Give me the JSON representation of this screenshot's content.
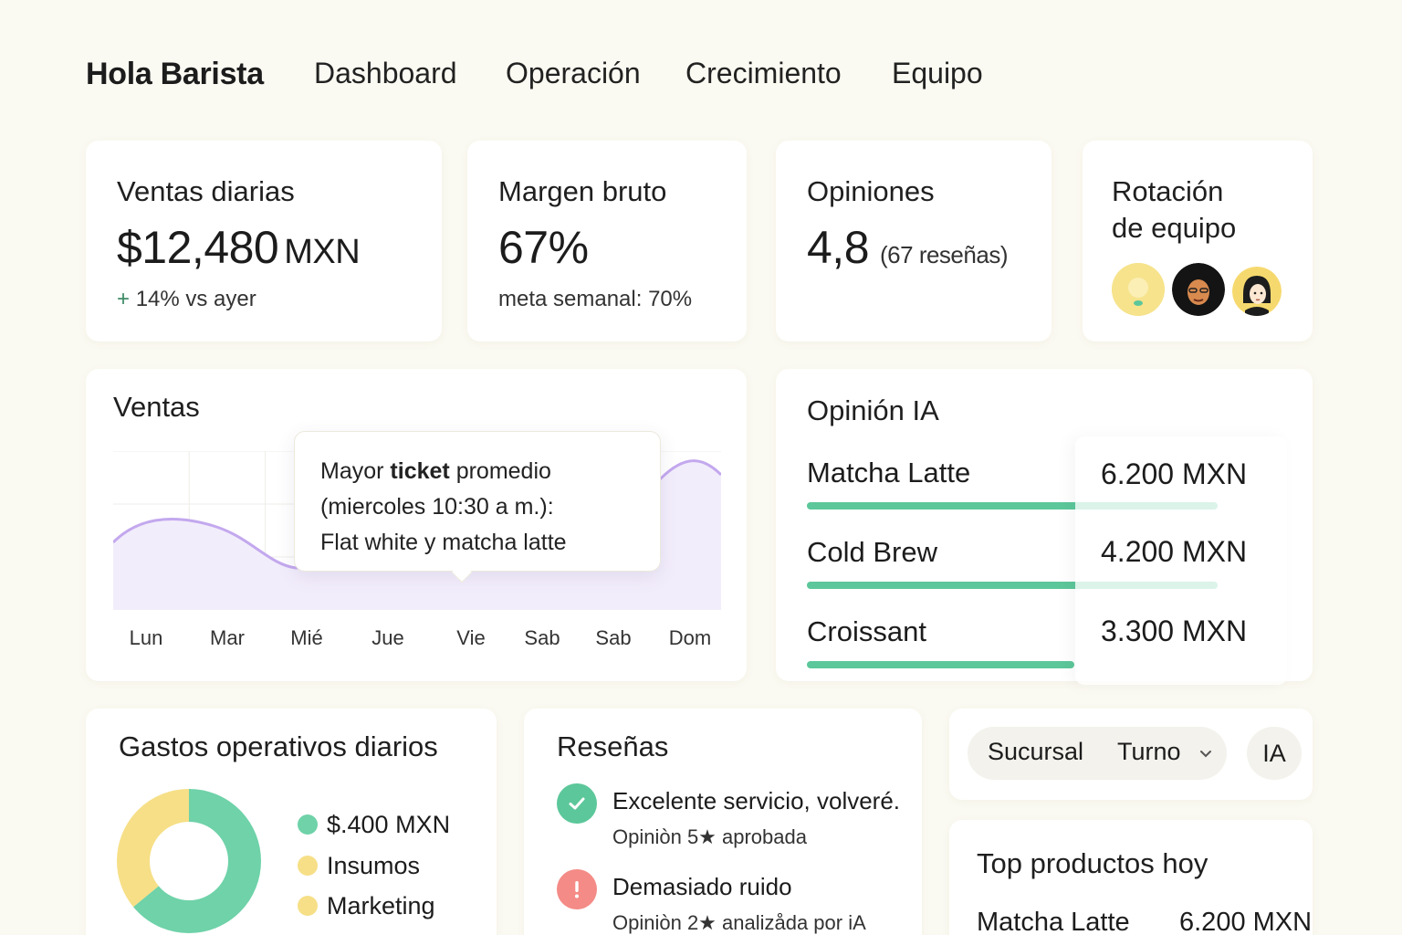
{
  "nav": {
    "brand": "Hola Barista",
    "links": [
      "Dashboard",
      "Operación",
      "Crecimiento",
      "Equipo"
    ]
  },
  "kpis": {
    "ventas": {
      "title": "Ventas diarias",
      "value": "$12,480",
      "unit": "MXN",
      "delta": "+",
      "sub": "14% vs ayer"
    },
    "margen": {
      "title": "Margen bruto",
      "value": "67%",
      "sub": "meta semanal: 70%"
    },
    "opiniones": {
      "title": "Opiniones",
      "value": "4,8",
      "count": "(67 reseñas)"
    },
    "rotacion": {
      "title_line1": "Rotación",
      "title_line2": "de equipo"
    }
  },
  "sales_chart": {
    "title": "Ventas",
    "days": [
      "Lun",
      "Mar",
      "Mié",
      "Jue",
      "Vie",
      "Sab",
      "Sab",
      "Dom"
    ],
    "line_color": "#c3a8ee",
    "area_color": "#f2edfb",
    "tooltip": {
      "prefix": "Mayor",
      "bold": "ticket",
      "suffix": "promedio",
      "line2": "(miercoles 10:30 a m.):",
      "line3": "Flat white y matcha latte"
    }
  },
  "opinion_ia": {
    "title": "Opinión IA",
    "products": [
      {
        "name": "Matcha Latte",
        "value": "6.200 MXN",
        "share": 1.0
      },
      {
        "name": "Cold Brew",
        "value": "4.200 MXN",
        "share": 1.0
      },
      {
        "name": "Croissant",
        "value": "3.300 MXN",
        "share": 0.65
      }
    ],
    "bar_color": "#5cc79a"
  },
  "gastos": {
    "title": "Gastos operativos diarios",
    "legend": [
      {
        "label": "$.400 MXN",
        "color": "#6fd2a9"
      },
      {
        "label": "Insumos",
        "color": "#f6df87"
      },
      {
        "label": "Marketing",
        "color": "#f6df87"
      }
    ],
    "donut": [
      {
        "share": 0.64,
        "color": "#6fd2a9"
      },
      {
        "share": 0.36,
        "color": "#f6df87"
      }
    ]
  },
  "resenas": {
    "title": "Reseñas",
    "items": [
      {
        "icon": "check-circle-icon",
        "text": "Excelente servicio, volveré.",
        "sub": "Opiniòn 5★ aprobada",
        "color": "#5cc79a"
      },
      {
        "icon": "alert-circle-icon",
        "text": "Demasiado ruido",
        "sub": "Opiniòn 2★ analizåda por iA",
        "color": "#f48b86"
      }
    ]
  },
  "filters": {
    "sucursal": "Sucursal",
    "turno": "Turno",
    "ia": "IA"
  },
  "top_productos": {
    "title": "Top productos hoy",
    "first": {
      "name": "Matcha Latte",
      "value": "6.200 MXN"
    }
  }
}
